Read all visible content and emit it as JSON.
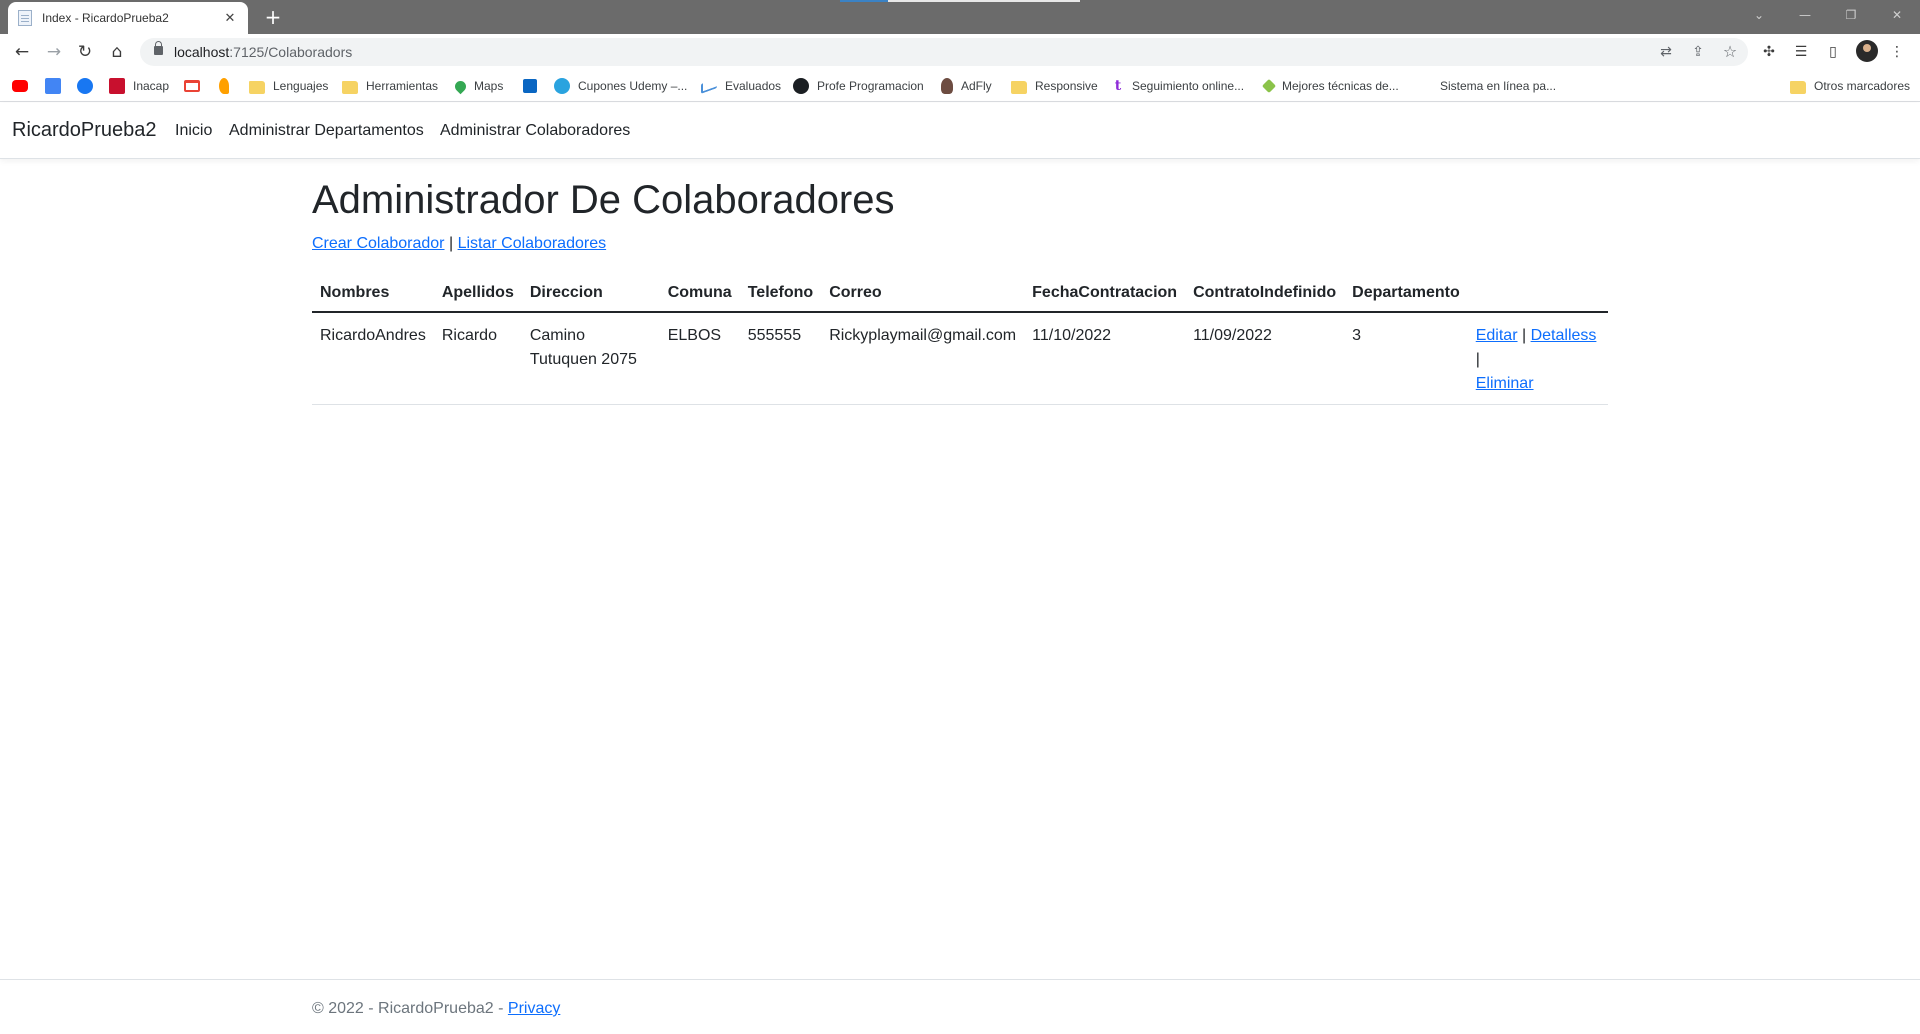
{
  "browser": {
    "tab_title": "Index - RicardoPrueba2",
    "tab_close": "✕",
    "new_tab": "+",
    "url_host": "localhost",
    "url_path": ":7125/Colaboradors",
    "window_controls": {
      "minimize": "—",
      "restore": "❐",
      "close": "✕"
    },
    "nav": {
      "back": "←",
      "forward": "→",
      "reload": "↻",
      "home": "⌂"
    },
    "icons": {
      "translate": "translate-icon",
      "share": "share-icon",
      "bookmark": "star-icon",
      "extensions": "puzzle-icon",
      "reading_list": "reading-list-icon",
      "side_panel": "side-panel-icon",
      "profile": "avatar",
      "menu": "kebab-menu-icon"
    },
    "glyphs": {
      "translate": "⇄",
      "share": "⇪",
      "star": "☆",
      "puzzle": "✣",
      "reading": "☰",
      "side": "▯",
      "menu": "⋮"
    },
    "bookmarks": [
      {
        "label": "",
        "icon": "youtube-icon"
      },
      {
        "label": "",
        "icon": "translate-icon"
      },
      {
        "label": "",
        "icon": "facebook-icon"
      },
      {
        "label": "Inacap",
        "icon": "inacap-icon"
      },
      {
        "label": "",
        "icon": "gmail-icon"
      },
      {
        "label": "",
        "icon": "orange-icon"
      },
      {
        "label": "Lenguajes",
        "icon": "folder-icon"
      },
      {
        "label": "Herramientas",
        "icon": "folder-icon"
      },
      {
        "label": "Maps",
        "icon": "maps-icon"
      },
      {
        "label": "",
        "icon": "linkedin-icon"
      },
      {
        "label": "Cupones Udemy –...",
        "icon": "telegram-icon"
      },
      {
        "label": "Evaluados",
        "icon": "chart-icon"
      },
      {
        "label": "Profe Programacion",
        "icon": "github-icon"
      },
      {
        "label": "AdFly",
        "icon": "adfly-icon"
      },
      {
        "label": "Responsive",
        "icon": "folder-icon"
      },
      {
        "label": "Seguimiento online...",
        "icon": "t-icon"
      },
      {
        "label": "Mejores técnicas de...",
        "icon": "diamond-icon"
      },
      {
        "label": "Sistema en línea pa...",
        "icon": ""
      },
      {
        "label": "Otros marcadores",
        "icon": "folder-icon"
      }
    ]
  },
  "site": {
    "brand": "RicardoPrueba2",
    "nav": [
      "Inicio",
      "Administrar Departamentos",
      "Administrar Colaboradores"
    ]
  },
  "main": {
    "title": "Administrador De Colaboradores",
    "links": {
      "create": "Crear Colaborador",
      "separator": "|",
      "list": "Listar Colaboradores"
    },
    "table": {
      "headers": [
        "Nombres",
        "Apellidos",
        "Direccion",
        "Comuna",
        "Telefono",
        "Correo",
        "FechaContratacion",
        "ContratoIndefinido",
        "Departamento"
      ],
      "rows": [
        {
          "nombres": "RicardoAndres",
          "apellidos": "Ricardo",
          "direccion_l1": "Camino",
          "direccion_l2": "Tutuquen 2075",
          "comuna": "ELBOS",
          "telefono": "555555",
          "correo": "Rickyplaymail@gmail.com",
          "fecha_contratacion": "11/10/2022",
          "contrato_indefinido": "11/09/2022",
          "departamento": "3",
          "actions": {
            "edit": "Editar",
            "details": "Detalless",
            "delete": "Eliminar",
            "separator": "|"
          }
        }
      ]
    }
  },
  "footer": {
    "text": "© 2022 - RicardoPrueba2 - ",
    "privacy": "Privacy"
  },
  "colors": {
    "link": "#0d6efd",
    "text": "#212529",
    "muted": "#6c757d",
    "chrome_tabstrip": "#6b6b6b"
  }
}
